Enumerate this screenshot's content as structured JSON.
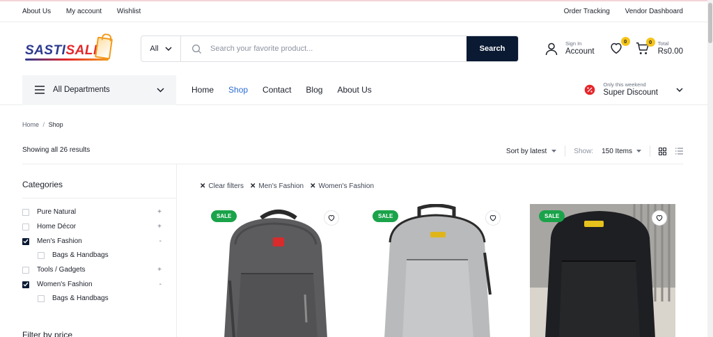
{
  "topbar": {
    "left_links": [
      "About Us",
      "My account",
      "Wishlist"
    ],
    "right_links": [
      "Order Tracking",
      "Vendor Dashboard"
    ]
  },
  "logo": {
    "text_part1": "SASTI",
    "text_part2": "SALE"
  },
  "search": {
    "category": "All",
    "placeholder": "Search your favorite product...",
    "button": "Search"
  },
  "account": {
    "small": "Sign In",
    "big": "Account"
  },
  "wishlist": {
    "count": "0"
  },
  "cart": {
    "count": "0",
    "small": "Total",
    "big": "Rs0.00"
  },
  "departments": {
    "label": "All Departments"
  },
  "menu": [
    {
      "label": "Home",
      "active": false
    },
    {
      "label": "Shop",
      "active": true
    },
    {
      "label": "Contact",
      "active": false
    },
    {
      "label": "Blog",
      "active": false
    },
    {
      "label": "About Us",
      "active": false
    }
  ],
  "promo": {
    "small": "Only this weekend",
    "big": "Super Discount"
  },
  "breadcrumb": {
    "home": "Home",
    "sep": "/",
    "current": "Shop"
  },
  "results_text": "Showing all 26 results",
  "sort": {
    "label": "Sort by latest"
  },
  "show": {
    "label": "Show:",
    "value": "150 Items"
  },
  "sidebar": {
    "title": "Categories",
    "categories": [
      {
        "label": "Pure Natural",
        "checked": false,
        "toggle": "+",
        "sub": false
      },
      {
        "label": "Home Décor",
        "checked": false,
        "toggle": "+",
        "sub": false
      },
      {
        "label": "Men's Fashion",
        "checked": true,
        "toggle": "-",
        "sub": false
      },
      {
        "label": "Bags & Handbags",
        "checked": false,
        "toggle": "",
        "sub": true
      },
      {
        "label": "Tools / Gadgets",
        "checked": false,
        "toggle": "+",
        "sub": false
      },
      {
        "label": "Women's Fashion",
        "checked": true,
        "toggle": "-",
        "sub": false
      },
      {
        "label": "Bags & Handbags",
        "checked": false,
        "toggle": "",
        "sub": true
      }
    ],
    "filter_price": "Filter by price"
  },
  "chips": [
    "Clear filters",
    "Men's Fashion",
    "Women's Fashion"
  ],
  "products": [
    {
      "badge": "SALE",
      "color": "dark-grey"
    },
    {
      "badge": "SALE",
      "color": "light-grey"
    },
    {
      "badge": "SALE",
      "color": "black"
    }
  ],
  "colors": {
    "accent": "#2b6cd4",
    "primary": "#0b1a33",
    "badge_yellow": "#f5c419",
    "sale_green": "#1aa34a"
  }
}
